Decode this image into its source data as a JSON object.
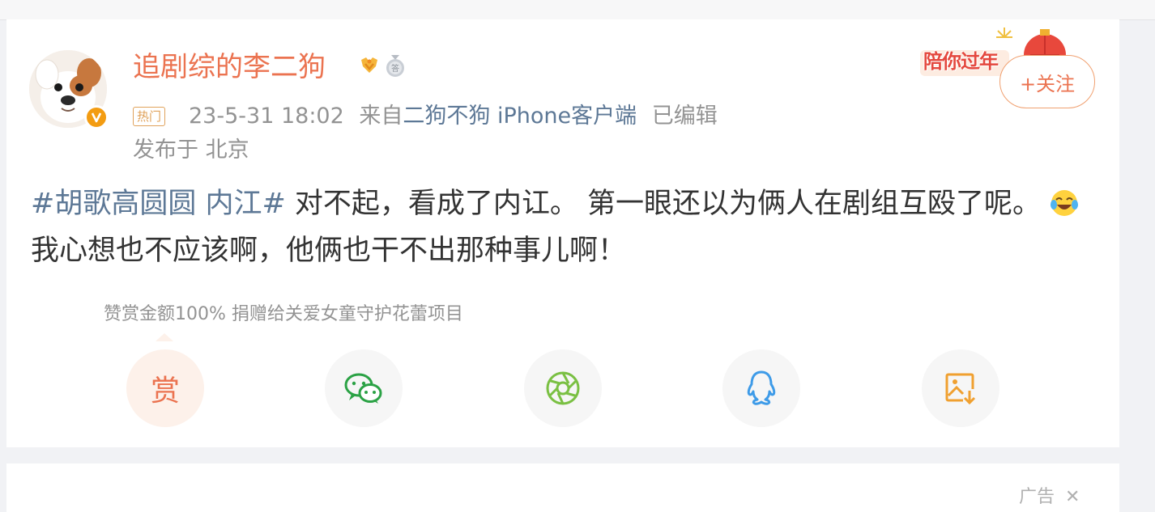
{
  "post": {
    "username": "追剧综的李二狗",
    "hot_badge": "热门",
    "timestamp": "23-5-31 18:02",
    "source_prefix": "来自",
    "source_name": "二狗不狗 iPhone客户端",
    "edited": "已编辑",
    "location": "发布于 北京",
    "follow_label": "+关注",
    "festive_banner": "陪你过年",
    "hashtag": "#胡歌高圆圆 内江#",
    "text_part1": " 对不起，看成了内讧。 第一眼还以为俩人在剧组互殴了呢。",
    "text_part2": " 我心想也不应该啊，他俩也干不出那种事儿啊！",
    "emoji_name": "laughing-crying-emoji"
  },
  "reward": {
    "note": "赞赏金额100% 捐赠给关爱女童守护花蕾项目",
    "label": "赏"
  },
  "share": {
    "items": [
      "wechat-icon",
      "moments-icon",
      "qq-icon",
      "save-image-icon"
    ]
  },
  "next_card": {
    "ad_label": "广告"
  },
  "colors": {
    "username": "#eb7350",
    "link": "#5d7896",
    "meta": "#939393",
    "wechat": "#2ba245",
    "moments": "#7ac043",
    "qq": "#3e9be8",
    "save": "#f0a030"
  }
}
